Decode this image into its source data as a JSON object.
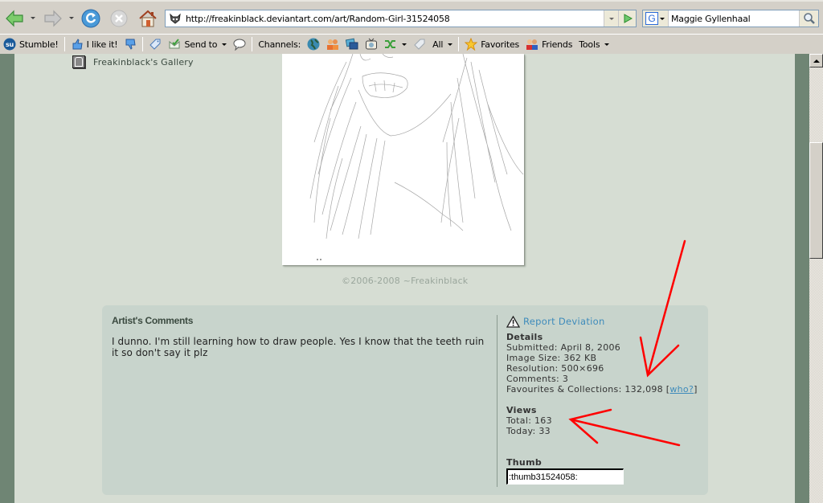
{
  "browser": {
    "nav": {
      "back": "Back",
      "forward": "Forward",
      "refresh": "Refresh",
      "stop": "Stop",
      "home": "Home"
    },
    "url": "http://freakinblack.deviantart.com/art/Random-Girl-31524058",
    "search": {
      "engine": "G",
      "value": "Maggie Gyllenhaal"
    }
  },
  "toolbar": {
    "stumble": "Stumble!",
    "like": "I like it!",
    "send_to": "Send to",
    "channels": "Channels:",
    "all": "All",
    "favorites": "Favorites",
    "friends": "Friends",
    "tools": "Tools"
  },
  "page": {
    "gallery_link": "Freakinblack's Gallery",
    "copyright": "©2006-2008 ~Freakinblack",
    "comments": {
      "title": "Artist's Comments",
      "text": "I dunno. I'm still learning how to draw people. Yes I know that the teeth ruin it so don't say it plz"
    },
    "report": "Report Deviation",
    "details": {
      "title": "Details",
      "submitted": "Submitted: April 8, 2006",
      "image_size": "Image Size: 362 KB",
      "resolution": "Resolution: 500×696",
      "comments": "Comments: 3",
      "favourites": "Favourites & Collections: 132,098",
      "who": "who?"
    },
    "views": {
      "title": "Views",
      "total": "Total: 163",
      "today": "Today: 33"
    },
    "thumb": {
      "title": "Thumb",
      "value": ":thumb31524058:"
    }
  },
  "colors": {
    "annotation": "#ff0000",
    "link": "#3e8bbb",
    "page_bg": "#d6ddd3",
    "panel_bg": "#c8d4cc",
    "frame": "#6f8574"
  }
}
